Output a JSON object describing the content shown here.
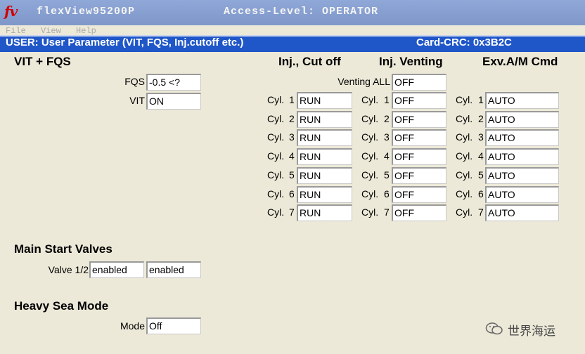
{
  "window": {
    "logo": "fv",
    "app_title": "flexView95200P",
    "access_level": "Access-Level: OPERATOR"
  },
  "menu": [
    "File",
    "View",
    "Help"
  ],
  "header": {
    "title": "USER: User Parameter (VIT, FQS, Inj.cutoff etc.)",
    "crc": "Card-CRC: 0x3B2C",
    "colors": {
      "band": "#1f56c8",
      "text": "#ffffff"
    }
  },
  "vit_fqs": {
    "title": "VIT + FQS",
    "fqs_label": "FQS",
    "fqs_value": "-0.5 <?",
    "vit_label": "VIT",
    "vit_value": "ON"
  },
  "columns": {
    "inj_cutoff": "Inj., Cut off",
    "inj_venting": "Inj. Venting",
    "exv_cmd": "Exv.A/M Cmd"
  },
  "venting_all": {
    "label": "Venting ALL",
    "value": "OFF"
  },
  "cylinders": [
    {
      "label": "Cyl.",
      "num": "1",
      "cutoff": "RUN",
      "venting": "OFF",
      "exv": "AUTO"
    },
    {
      "label": "Cyl.",
      "num": "2",
      "cutoff": "RUN",
      "venting": "OFF",
      "exv": "AUTO"
    },
    {
      "label": "Cyl.",
      "num": "3",
      "cutoff": "RUN",
      "venting": "OFF",
      "exv": "AUTO"
    },
    {
      "label": "Cyl.",
      "num": "4",
      "cutoff": "RUN",
      "venting": "OFF",
      "exv": "AUTO"
    },
    {
      "label": "Cyl.",
      "num": "5",
      "cutoff": "RUN",
      "venting": "OFF",
      "exv": "AUTO"
    },
    {
      "label": "Cyl.",
      "num": "6",
      "cutoff": "RUN",
      "venting": "OFF",
      "exv": "AUTO"
    },
    {
      "label": "Cyl.",
      "num": "7",
      "cutoff": "RUN",
      "venting": "OFF",
      "exv": "AUTO"
    }
  ],
  "main_start": {
    "title": "Main Start Valves",
    "label": "Valve 1/2",
    "valve1": "enabled",
    "valve2": "enabled"
  },
  "heavy_sea": {
    "title": "Heavy Sea Mode",
    "label": "Mode",
    "value": "Off"
  },
  "watermark": {
    "icon": "wechat-icon",
    "text": "世界海运"
  }
}
